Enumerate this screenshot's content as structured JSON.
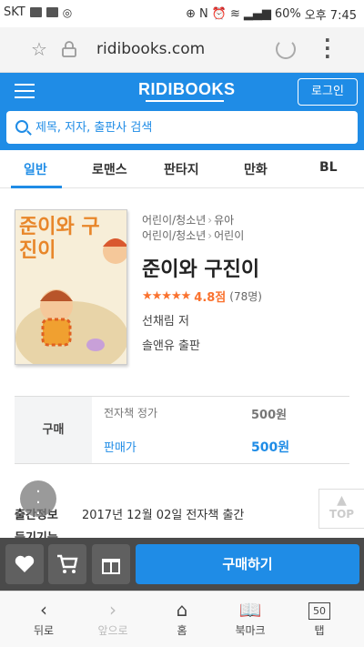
{
  "status_bar": {
    "carrier": "SKT",
    "battery": "60%",
    "time": "오후 7:45"
  },
  "url_bar": {
    "url": "ridibooks.com"
  },
  "header": {
    "logo": "RIDIBOOKS",
    "login_label": "로그인",
    "search_placeholder": "제목, 저자, 출판사 검색"
  },
  "tabs": [
    {
      "label": "일반",
      "active": true
    },
    {
      "label": "로맨스",
      "active": false
    },
    {
      "label": "판타지",
      "active": false
    },
    {
      "label": "만화",
      "active": false
    },
    {
      "label": "BL",
      "active": false
    }
  ],
  "book": {
    "categories": [
      {
        "parent": "어린이/청소년",
        "child": "유아"
      },
      {
        "parent": "어린이/청소년",
        "child": "어린이"
      }
    ],
    "title": "준이와 구진이",
    "cover_title": "준이와 구진이",
    "rating_score": "4.8점",
    "rating_count": "(78명)",
    "stars": "★★★★★",
    "author": "선채림 저",
    "publisher": "솔앤유 출판"
  },
  "price": {
    "label": "구매",
    "rows": [
      {
        "name": "전자책 정가",
        "value": "500원"
      },
      {
        "name": "판매가",
        "value": "500원"
      }
    ]
  },
  "info": {
    "publish_key": "출간정보",
    "publish_value": "2017년 12월 02일 전자책 출간",
    "partial_text": "듣기기능"
  },
  "top_button": "TOP",
  "buy_bar": {
    "buy_label": "구매하기"
  },
  "nav": [
    {
      "label": "뒤로",
      "icon": "‹"
    },
    {
      "label": "앞으로",
      "icon": "›"
    },
    {
      "label": "홈",
      "icon": "⌂"
    },
    {
      "label": "북마크",
      "icon": "📖"
    },
    {
      "label": "탭",
      "icon": "50"
    }
  ],
  "colors": {
    "brand": "#1f8ce6",
    "star": "#fa722e"
  }
}
